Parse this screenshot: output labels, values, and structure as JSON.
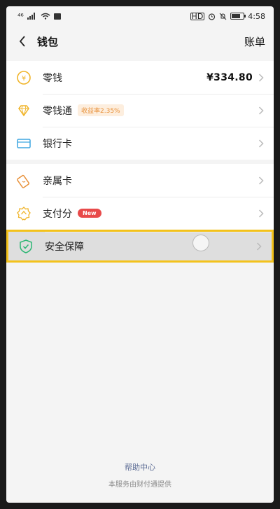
{
  "status_bar": {
    "left_text": "⁴⁶",
    "right_time": "4:58",
    "hd_label": "HD"
  },
  "navbar": {
    "title": "钱包",
    "right_link": "账单"
  },
  "groups": [
    {
      "items": [
        {
          "label": "零钱",
          "value": "¥334.80",
          "icon": "coin-icon"
        },
        {
          "label": "零钱通",
          "badge": "收益率2.35%",
          "icon": "diamond-icon"
        },
        {
          "label": "银行卡",
          "icon": "bank-card-icon"
        }
      ]
    },
    {
      "items": [
        {
          "label": "亲属卡",
          "icon": "family-card-icon"
        },
        {
          "label": "支付分",
          "badge": "New",
          "icon": "pay-score-icon"
        },
        {
          "label": "安全保障",
          "icon": "shield-icon"
        }
      ]
    }
  ],
  "footer": {
    "help": "帮助中心",
    "provider": "本服务由财付通提供"
  },
  "colors": {
    "accent_yellow": "#f3c21b",
    "icon_gold": "#f0b429",
    "icon_blue": "#3fa6e0",
    "icon_orange": "#e8913a",
    "icon_green": "#2bb673",
    "badge_red": "#e84a4a"
  }
}
